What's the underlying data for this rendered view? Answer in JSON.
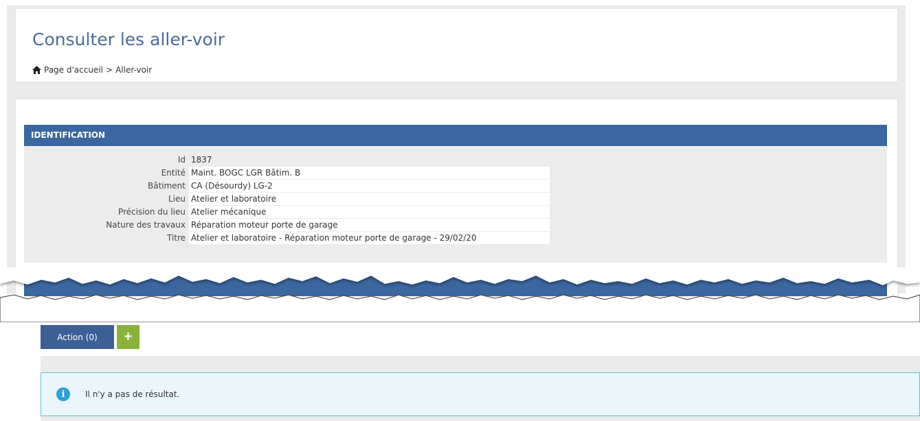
{
  "header": {
    "title": "Consulter les aller-voir",
    "breadcrumb": {
      "home": "Page d'accueil",
      "separator": ">",
      "current": "Aller-voir"
    }
  },
  "identification": {
    "section_title": "IDENTIFICATION",
    "fields": [
      {
        "label": "Id",
        "value": "1837"
      },
      {
        "label": "Entité",
        "value": "Maint. BOGC LGR Bâtim. B"
      },
      {
        "label": "Bâtiment",
        "value": "CA (Désourdy) LG-2"
      },
      {
        "label": "Lieu",
        "value": "Atelier et laboratoire"
      },
      {
        "label": "Précision du lieu",
        "value": "Atelier mécanique"
      },
      {
        "label": "Nature des travaux",
        "value": "Réparation moteur porte de garage"
      },
      {
        "label": "Titre",
        "value": "Atelier et laboratoire - Réparation moteur porte de garage - 29/02/20"
      }
    ]
  },
  "actions": {
    "tab_label": "Action (0)",
    "add_label": "+",
    "empty_message": "Il n'y a pas de résultat."
  },
  "colors": {
    "primary": "#3c66a0",
    "success": "#8ab33a",
    "info": "#2aa3d9"
  }
}
